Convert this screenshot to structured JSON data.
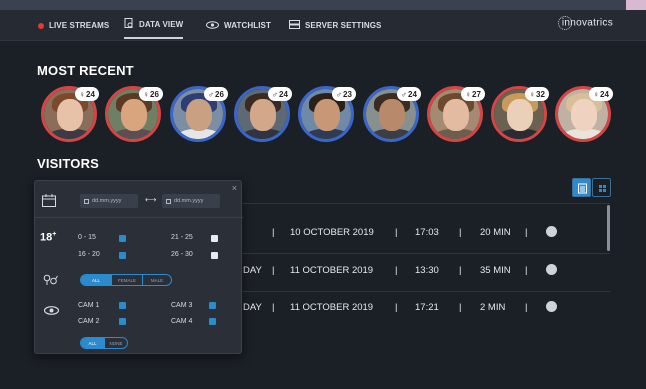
{
  "nav": {
    "items": [
      {
        "label": "LIVE STREAMS"
      },
      {
        "label": "DATA VIEW"
      },
      {
        "label": "WATCHLIST"
      },
      {
        "label": "SERVER SETTINGS"
      }
    ],
    "logo": "innovatrics"
  },
  "most_recent": {
    "title": "MOST RECENT",
    "faces": [
      {
        "gender": "♀",
        "age": "24",
        "border": "#d64545"
      },
      {
        "gender": "♀",
        "age": "26",
        "border": "#d64545"
      },
      {
        "gender": "♂",
        "age": "26",
        "border": "#3b66c9"
      },
      {
        "gender": "♂",
        "age": "24",
        "border": "#3b66c9"
      },
      {
        "gender": "♂",
        "age": "23",
        "border": "#3b66c9"
      },
      {
        "gender": "♂",
        "age": "24",
        "border": "#3b66c9"
      },
      {
        "gender": "♀",
        "age": "27",
        "border": "#d64545"
      },
      {
        "gender": "♀",
        "age": "32",
        "border": "#d64545"
      },
      {
        "gender": "♀",
        "age": "24",
        "border": "#d64545"
      }
    ]
  },
  "visitors": {
    "title": "VISITORS",
    "rows": [
      {
        "prefix": "",
        "date": "10 OCTOBER 2019",
        "time": "17:03",
        "duration": "20 MIN"
      },
      {
        "prefix": "DAY",
        "date": "11 OCTOBER 2019",
        "time": "13:30",
        "duration": "35 MIN"
      },
      {
        "prefix": "DAY",
        "date": "11 OCTOBER 2019",
        "time": "17:21",
        "duration": "2 MIN"
      }
    ],
    "sep": "|"
  },
  "filter": {
    "close": "×",
    "date_from_placeholder": "dd.mm.yyyy",
    "date_to_placeholder": "dd.mm.yyyy",
    "date_arrow": "⟷",
    "age_label": "18",
    "age_plus": "+",
    "age_ranges": [
      {
        "label": "0 - 15",
        "checked": true
      },
      {
        "label": "21 - 25",
        "checked": false
      },
      {
        "label": "16 - 20",
        "checked": true
      },
      {
        "label": "26 - 30",
        "checked": false
      }
    ],
    "gender_options": [
      "ALL",
      "FEMALE",
      "MALE"
    ],
    "cameras": [
      {
        "label": "CAM 1",
        "checked": true
      },
      {
        "label": "CAM 3",
        "checked": true
      },
      {
        "label": "CAM 2",
        "checked": true
      },
      {
        "label": "CAM 4",
        "checked": true
      }
    ],
    "cam_options": [
      "ALL",
      "NONE"
    ]
  },
  "colors": {
    "accent": "#2c8bcf",
    "female": "#d64545",
    "male": "#3b66c9",
    "live": "#e53935"
  }
}
